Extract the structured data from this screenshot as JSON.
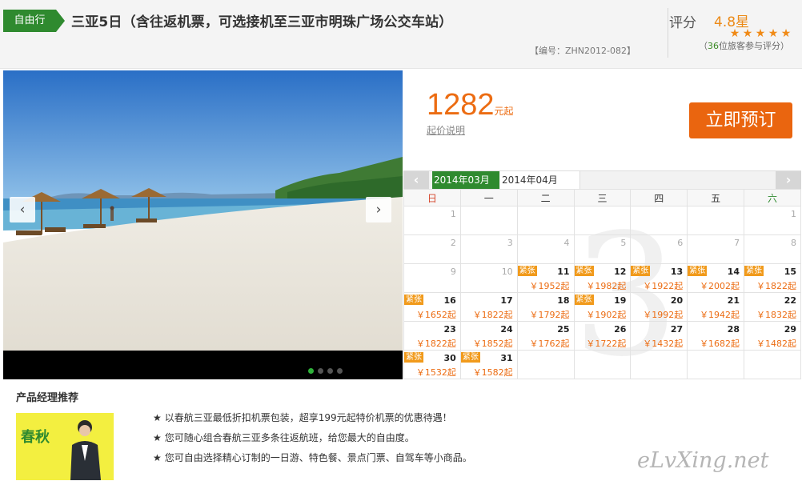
{
  "header": {
    "tag": "自由行",
    "title": "三亚5日（含往返机票，可选接机至三亚市明珠广场公交车站）",
    "code": "【编号：ZHN2012-082】",
    "rating_label": "评分",
    "rating_value": "4.8星",
    "stars": [
      "★",
      "★",
      "★",
      "★",
      "★"
    ],
    "reviews_prefix": "（",
    "reviews_count": "36",
    "reviews_suffix": "位旅客参与评分）"
  },
  "photo": {
    "prev_icon": "‹",
    "next_icon": "›",
    "dots": 4,
    "active_dot": 0
  },
  "price": {
    "amount": "1282",
    "suffix": "元起",
    "note": "起价说明",
    "book_label": "立即预订"
  },
  "calendar": {
    "prev_icon": "‹",
    "next_icon": "›",
    "months": [
      "2014年03月",
      "2014年04月"
    ],
    "weekdays": [
      "日",
      "一",
      "二",
      "三",
      "四",
      "五",
      "六"
    ],
    "weeks": [
      [
        {
          "day": "1"
        },
        {
          "day": ""
        },
        {
          "day": ""
        },
        {
          "day": ""
        },
        {
          "day": ""
        },
        {
          "day": ""
        },
        {
          "day": "1"
        }
      ],
      [
        {
          "day": "2"
        },
        {
          "day": "3"
        },
        {
          "day": "4"
        },
        {
          "day": "5"
        },
        {
          "day": "6"
        },
        {
          "day": "7"
        },
        {
          "day": "8"
        }
      ],
      [
        {
          "day": "9"
        },
        {
          "day": "10"
        },
        {
          "day": "11",
          "badge": "紧张",
          "price": "￥1952起"
        },
        {
          "day": "12",
          "badge": "紧张",
          "price": "￥1982起"
        },
        {
          "day": "13",
          "badge": "紧张",
          "price": "￥1922起"
        },
        {
          "day": "14",
          "badge": "紧张",
          "price": "￥2002起"
        },
        {
          "day": "15",
          "badge": "紧张",
          "price": "￥1822起"
        }
      ],
      [
        {
          "day": "16",
          "badge": "紧张",
          "price": "￥1652起"
        },
        {
          "day": "17",
          "price": "￥1822起"
        },
        {
          "day": "18",
          "price": "￥1792起"
        },
        {
          "day": "19",
          "badge": "紧张",
          "price": "￥1902起"
        },
        {
          "day": "20",
          "price": "￥1992起"
        },
        {
          "day": "21",
          "price": "￥1942起"
        },
        {
          "day": "22",
          "price": "￥1832起"
        }
      ],
      [
        {
          "day": "23",
          "price": "￥1822起"
        },
        {
          "day": "24",
          "price": "￥1852起"
        },
        {
          "day": "25",
          "price": "￥1762起"
        },
        {
          "day": "26",
          "price": "￥1722起"
        },
        {
          "day": "27",
          "price": "￥1432起"
        },
        {
          "day": "28",
          "price": "￥1682起"
        },
        {
          "day": "29",
          "price": "￥1482起"
        }
      ],
      [
        {
          "day": "30",
          "badge": "紧张",
          "price": "￥1532起"
        },
        {
          "day": "31",
          "badge": "紧张",
          "price": "￥1582起"
        },
        {
          "day": ""
        },
        {
          "day": ""
        },
        {
          "day": ""
        },
        {
          "day": ""
        },
        {
          "day": ""
        }
      ]
    ]
  },
  "manager": {
    "title": "产品经理推荐",
    "photo_text": "春秋",
    "bullets": [
      "以春航三亚最低折扣机票包装，超享199元起特价机票的优惠待遇！",
      "您可随心组合春航三亚多条往返航班，给您最大的自由度。",
      "您可自由选择精心订制的一日游、特色餐、景点门票、自驾车等小商品。"
    ],
    "star": "★"
  },
  "watermark": "eLvXing.net"
}
